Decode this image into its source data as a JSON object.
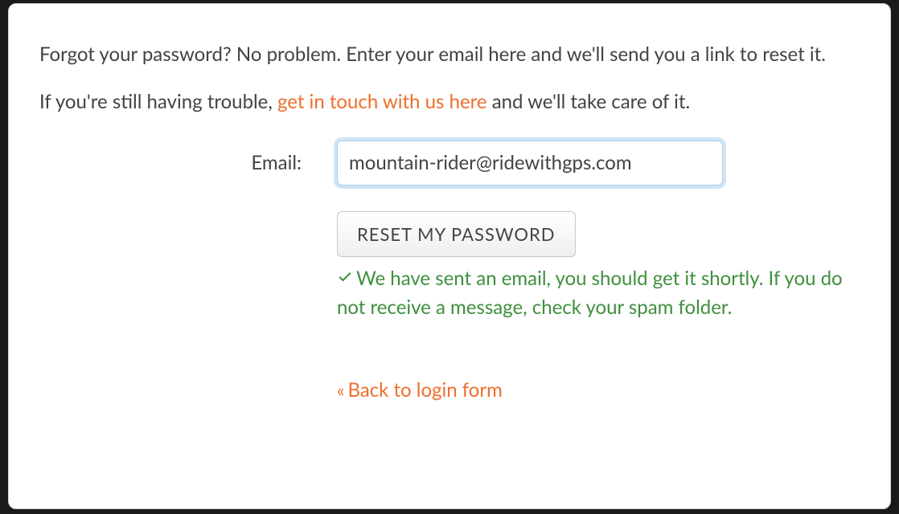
{
  "intro": {
    "line1": "Forgot your password? No problem. Enter your email here and we'll send you a link to reset it.",
    "line2_pre": "If you're still having trouble, ",
    "line2_link": "get in touch with us here",
    "line2_post": " and we'll take care of it."
  },
  "form": {
    "email_label": "Email:",
    "email_value": "mountain-rider@ridewithgps.com",
    "reset_button": "RESET MY PASSWORD"
  },
  "success": {
    "message": "We have sent an email, you should get it shortly. If you do not receive a message, check your spam folder."
  },
  "back": {
    "arrow": "«",
    "label": "Back to login form"
  },
  "colors": {
    "accent": "#ee6f2d",
    "success": "#3f8f3f",
    "text": "#434343"
  }
}
